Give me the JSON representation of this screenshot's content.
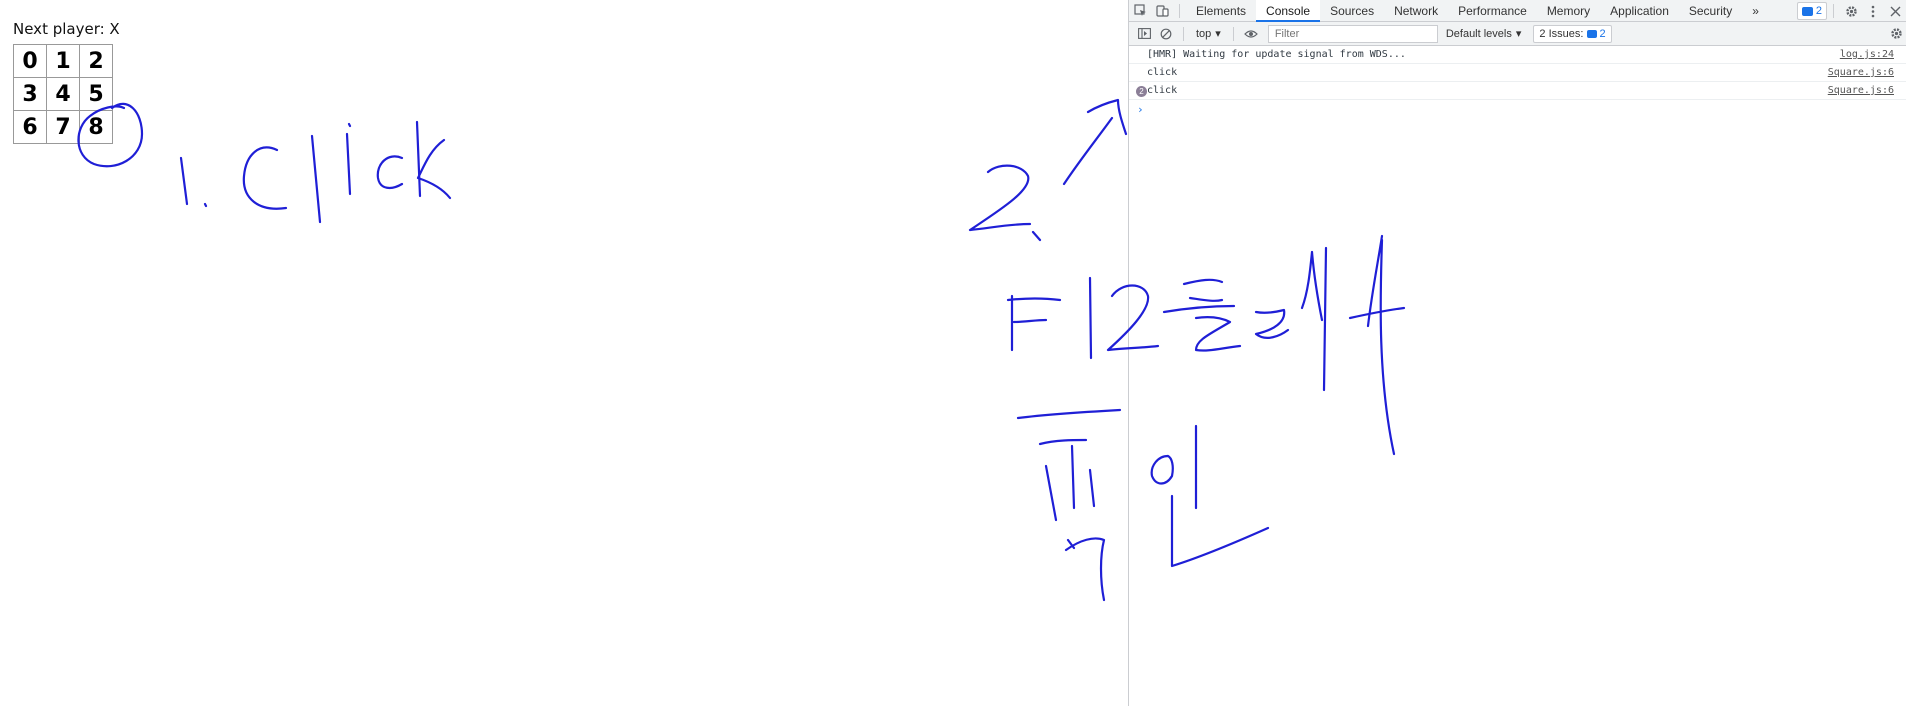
{
  "app": {
    "status": "Next player: X",
    "board": [
      [
        "0",
        "1",
        "2"
      ],
      [
        "3",
        "4",
        "5"
      ],
      [
        "6",
        "7",
        "8"
      ]
    ]
  },
  "devtools": {
    "tabs": [
      "Elements",
      "Console",
      "Sources",
      "Network",
      "Performance",
      "Memory",
      "Application",
      "Security"
    ],
    "active_tab": "Console",
    "more_tabs": "»",
    "issues_badge_count": "2",
    "toolbar": {
      "context": "top",
      "filter_placeholder": "Filter",
      "levels": "Default levels",
      "issues_label": "2 Issues:",
      "issues_count": "2"
    },
    "console": [
      {
        "message": "[HMR] Waiting for update signal from WDS...",
        "source": "log.js:24"
      },
      {
        "message": "click",
        "source": "Square.js:6"
      },
      {
        "message": "click",
        "source": "Square.js:6",
        "repeat": "2"
      }
    ],
    "prompt": "›"
  },
  "annotations": {
    "ink_color": "#1f1fd6",
    "step1": "1. click",
    "step2": "2.",
    "korean_line1": "F12 눌러서",
    "korean_line2": "확인"
  }
}
